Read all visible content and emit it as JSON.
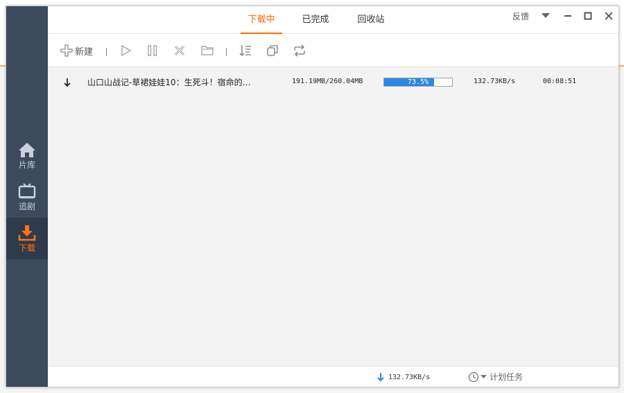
{
  "colors": {
    "accent": "#ff6a00",
    "sidebar_bg": "#3c4a5c",
    "progress_fill": "#2f86e0"
  },
  "sidebar": {
    "items": [
      {
        "label": "片库",
        "icon": "home-icon",
        "active": false
      },
      {
        "label": "追剧",
        "icon": "tv-icon",
        "active": false
      },
      {
        "label": "下载",
        "icon": "download-icon",
        "active": true
      }
    ]
  },
  "header": {
    "tabs": [
      {
        "label": "下载中",
        "active": true
      },
      {
        "label": "已完成",
        "active": false
      },
      {
        "label": "回收站",
        "active": false
      }
    ],
    "feedback_label": "反馈"
  },
  "toolbar": {
    "new_label": "新建",
    "icons": [
      "plus-icon",
      "play-icon",
      "pause-icon",
      "delete-icon",
      "folder-icon",
      "sort-icon",
      "copy-icon",
      "repeat-icon"
    ]
  },
  "downloads": [
    {
      "title": "山口山战记-草裙娃娃10：生死斗！宿命的…",
      "size": "191.19MB/260.04MB",
      "progress": 0.735,
      "progress_text": "73.5%",
      "speed": "132.73KB/s",
      "remaining": "00:08:51"
    }
  ],
  "statusbar": {
    "total_speed": "132.73KB/s",
    "schedule_label": "计划任务"
  }
}
